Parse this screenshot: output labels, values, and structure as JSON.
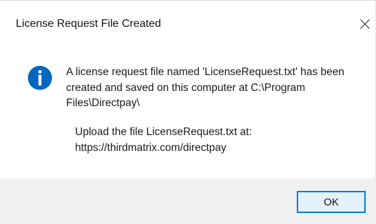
{
  "dialog": {
    "title": "License Request File Created",
    "message": "A license request file named 'LicenseRequest.txt' has been created and saved on this computer at C:\\Program Files\\Directpay\\",
    "upload_line1": "Upload the file LicenseRequest.txt at:",
    "upload_line2": "https://thirdmatrix.com/directpay",
    "ok_label": "OK"
  },
  "icons": {
    "info": "information-icon",
    "close": "close-icon"
  },
  "colors": {
    "info_blue": "#0067c0",
    "button_border": "#0078d7",
    "button_fill": "#e5f1fb",
    "footer_bg": "#f0f0f0"
  }
}
